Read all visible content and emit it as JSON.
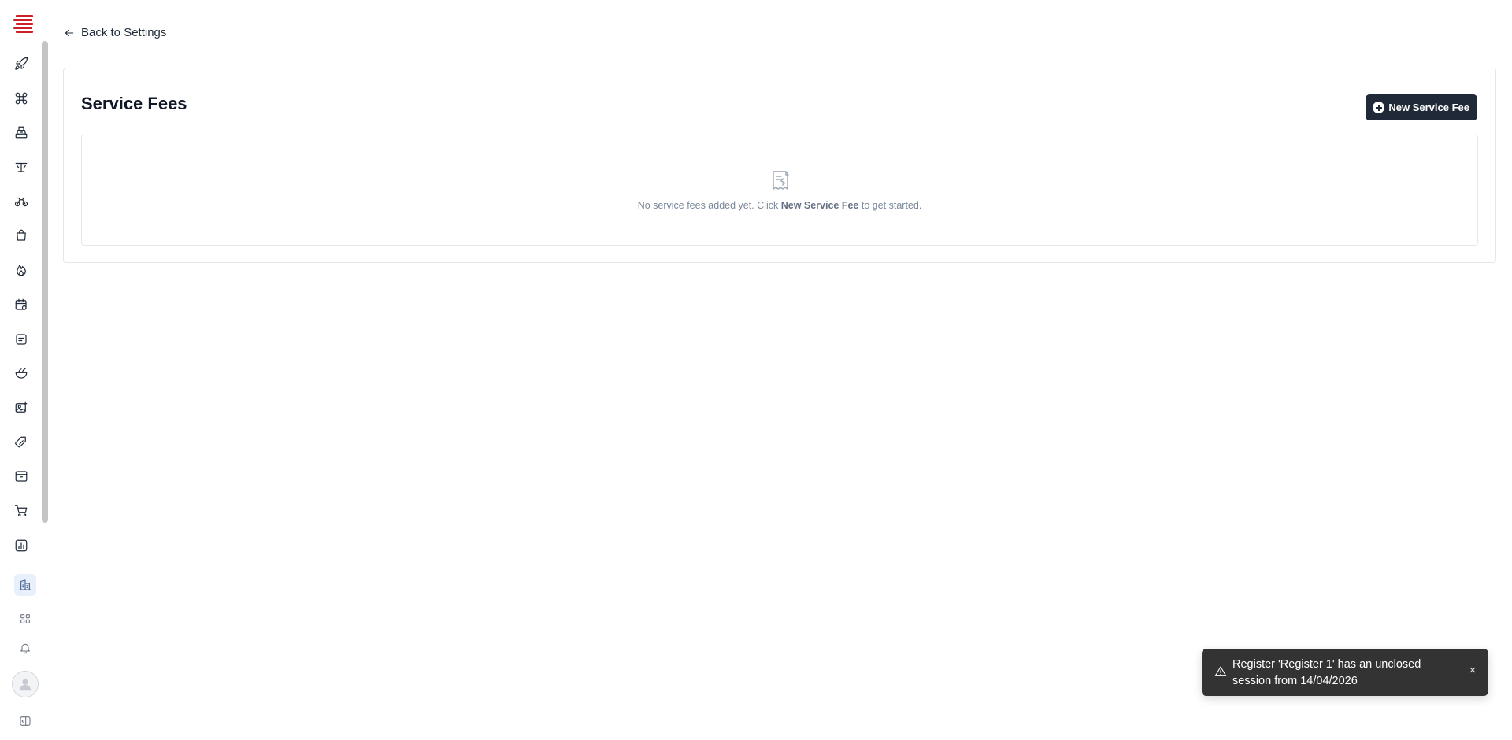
{
  "sidebar": {
    "logo": "brand-logo",
    "nav_icons": [
      "rocket-icon",
      "command-icon",
      "cash-register-icon",
      "dining-table-icon",
      "bicycle-delivery-icon",
      "shopping-bag-icon",
      "flame-icon",
      "calendar-settings-icon",
      "receipt-note-icon",
      "food-bowl-icon",
      "image-plus-icon",
      "discount-tag-icon",
      "archive-box-icon",
      "shopping-cart-icon",
      "bar-chart-icon"
    ],
    "bottom_icons": [
      "building-icon",
      "apps-grid-icon",
      "bell-icon",
      "user-avatar",
      "sidebar-toggle-icon"
    ]
  },
  "header": {
    "back_label": "Back to Settings"
  },
  "service_fees": {
    "title": "Service Fees",
    "new_button_label": "New Service Fee",
    "empty_state": {
      "text_before": "No service fees added yet. Click ",
      "text_bold": "New Service Fee",
      "text_after": " to get started."
    }
  },
  "toast": {
    "message": "Register 'Register 1' has an unclosed session from 14/04/2026",
    "close_label": "×"
  },
  "colors": {
    "primary_button": "#1f2937",
    "toast_bg": "#333333",
    "logo_red": "#cc1f27",
    "active_nav_bg": "#e8f1fb"
  }
}
